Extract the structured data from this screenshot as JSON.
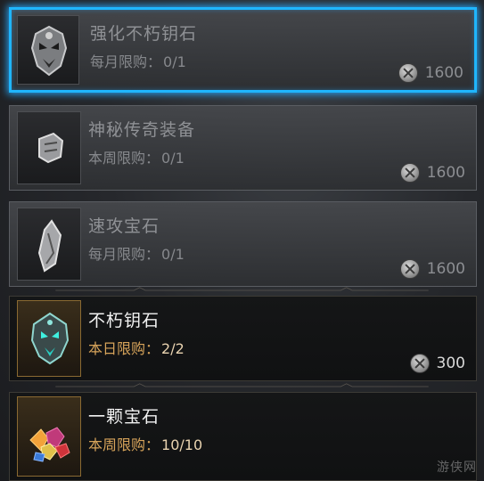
{
  "items": [
    {
      "name": "强化不朽钥石",
      "limit_label": "每月限购：",
      "limit_value": "0/1",
      "price": "1600",
      "icon": "demon-mask-key-icon"
    },
    {
      "name": "神秘传奇装备",
      "limit_label": "本周限购：",
      "limit_value": "0/1",
      "price": "1600",
      "icon": "armor-gauntlet-icon"
    },
    {
      "name": "速攻宝石",
      "limit_label": "每月限购：",
      "limit_value": "0/1",
      "price": "1600",
      "icon": "crystal-gem-icon"
    },
    {
      "name": "不朽钥石",
      "limit_label": "本日限购：",
      "limit_value": "2/2",
      "price": "300",
      "icon": "immortal-key-icon"
    },
    {
      "name": "一颗宝石",
      "limit_label": "本周限购：",
      "limit_value": "10/10",
      "price": "",
      "icon": "gem-pile-icon"
    }
  ],
  "currency_icon": "platinum-coin-icon",
  "watermark": "游侠网",
  "colors": {
    "selected_border": "#1fb6ff",
    "limit_active": "#d6a35a"
  }
}
